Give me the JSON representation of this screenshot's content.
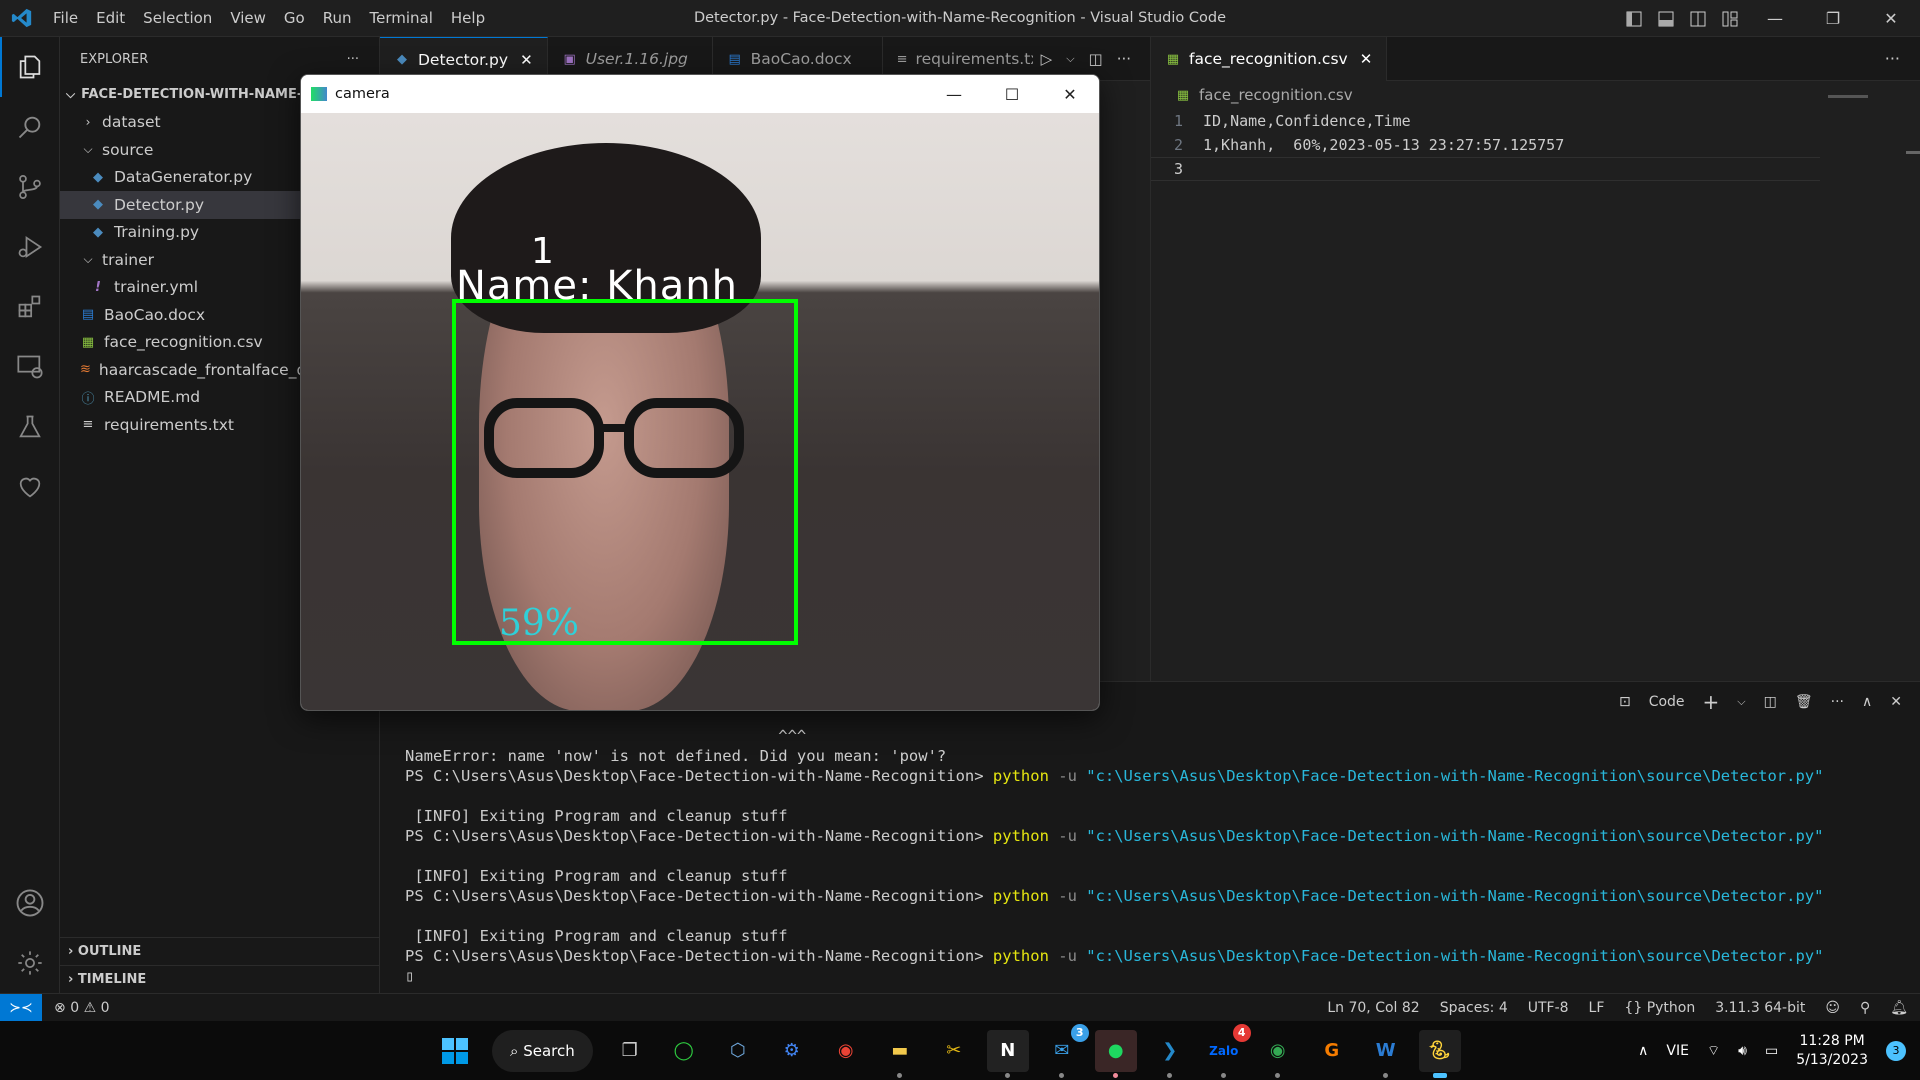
{
  "window": {
    "title": "Detector.py - Face-Detection-with-Name-Recognition - Visual Studio Code",
    "menu": [
      "File",
      "Edit",
      "Selection",
      "View",
      "Go",
      "Run",
      "Terminal",
      "Help"
    ]
  },
  "activity_bar": [
    "explorer-icon",
    "search-icon",
    "source-control-icon",
    "run-debug-icon",
    "extensions-icon",
    "remote-explorer-icon",
    "testing-icon",
    "favorites-icon"
  ],
  "sidebar": {
    "header": "EXPLORER",
    "more": "···",
    "root": "FACE-DETECTION-WITH-NAME-RECOGNITION",
    "items": [
      {
        "label": "dataset",
        "type": "folder",
        "expanded": false,
        "depth": 1
      },
      {
        "label": "source",
        "type": "folder",
        "expanded": true,
        "depth": 1
      },
      {
        "label": "DataGenerator.py",
        "type": "python",
        "depth": 2
      },
      {
        "label": "Detector.py",
        "type": "python",
        "depth": 2,
        "selected": true
      },
      {
        "label": "Training.py",
        "type": "python",
        "depth": 2
      },
      {
        "label": "trainer",
        "type": "folder",
        "expanded": true,
        "depth": 1
      },
      {
        "label": "trainer.yml",
        "type": "yaml",
        "depth": 2
      },
      {
        "label": "BaoCao.docx",
        "type": "word",
        "depth": 1
      },
      {
        "label": "face_recognition.csv",
        "type": "csv",
        "depth": 1
      },
      {
        "label": "haarcascade_frontalface_default.xml",
        "type": "xml",
        "depth": 1
      },
      {
        "label": "README.md",
        "type": "info",
        "depth": 1
      },
      {
        "label": "requirements.txt",
        "type": "text",
        "depth": 1
      }
    ],
    "outline": "OUTLINE",
    "timeline": "TIMELINE"
  },
  "tabs_left": [
    {
      "label": "Detector.py",
      "active": true,
      "close": "✕"
    },
    {
      "label": "User.1.16.jpg",
      "italic": true
    },
    {
      "label": "BaoCao.docx"
    },
    {
      "label": "requirements.txt"
    }
  ],
  "tabs_right": [
    {
      "label": "face_recognition.csv",
      "active": true,
      "close": "✕"
    }
  ],
  "csv_editor": {
    "breadcrumb": "face_recognition.csv",
    "lines": [
      {
        "n": "1",
        "text": "ID,Name,Confidence,Time"
      },
      {
        "n": "2",
        "text": "1,Khanh,  60%,2023-05-13 23:27:57.125757"
      },
      {
        "n": "3",
        "text": ""
      }
    ]
  },
  "camera_window": {
    "title": "camera",
    "overlay_id": "1",
    "overlay_name": "Name: Khanh",
    "overlay_confidence": "59%",
    "box_color": "#00ff00",
    "confidence_color": "#2fd0d8"
  },
  "panel": {
    "terminal_name": "Code",
    "lines": [
      {
        "plain": "                                        ^^^"
      },
      {
        "plain": "NameError: name 'now' is not defined. Did you mean: 'pow'?"
      },
      {
        "prompt": "PS C:\\Users\\Asus\\Desktop\\Face-Detection-with-Name-Recognition> ",
        "cmd": "python",
        "flag": " -u ",
        "path": "\"c:\\Users\\Asus\\Desktop\\Face-Detection-with-Name-Recognition\\source\\Detector.py\""
      },
      {
        "plain": ""
      },
      {
        "plain": " [INFO] Exiting Program and cleanup stuff"
      },
      {
        "prompt": "PS C:\\Users\\Asus\\Desktop\\Face-Detection-with-Name-Recognition> ",
        "cmd": "python",
        "flag": " -u ",
        "path": "\"c:\\Users\\Asus\\Desktop\\Face-Detection-with-Name-Recognition\\source\\Detector.py\""
      },
      {
        "plain": ""
      },
      {
        "plain": " [INFO] Exiting Program and cleanup stuff"
      },
      {
        "prompt": "PS C:\\Users\\Asus\\Desktop\\Face-Detection-with-Name-Recognition> ",
        "cmd": "python",
        "flag": " -u ",
        "path": "\"c:\\Users\\Asus\\Desktop\\Face-Detection-with-Name-Recognition\\source\\Detector.py\""
      },
      {
        "plain": ""
      },
      {
        "plain": " [INFO] Exiting Program and cleanup stuff"
      },
      {
        "prompt": "PS C:\\Users\\Asus\\Desktop\\Face-Detection-with-Name-Recognition> ",
        "cmd": "python",
        "flag": " -u ",
        "path": "\"c:\\Users\\Asus\\Desktop\\Face-Detection-with-Name-Recognition\\source\\Detector.py\""
      },
      {
        "plain": "▯"
      }
    ]
  },
  "status_bar": {
    "errors": "0",
    "warnings": "0",
    "position": "Ln 70, Col 82",
    "spaces": "Spaces: 4",
    "encoding": "UTF-8",
    "eol": "LF",
    "language": "Python",
    "interpreter": "3.11.3 64-bit"
  },
  "taskbar": {
    "search": "Search",
    "apps": [
      {
        "name": "task-view",
        "badge": null
      },
      {
        "name": "obs",
        "badge": null
      },
      {
        "name": "virtualbox",
        "badge": null
      },
      {
        "name": "android-studio",
        "badge": null
      },
      {
        "name": "chrome",
        "badge": null
      },
      {
        "name": "file-explorer",
        "badge": null
      },
      {
        "name": "tools",
        "badge": null
      },
      {
        "name": "notion",
        "badge": null
      },
      {
        "name": "mail",
        "badge": "3"
      },
      {
        "name": "spotify",
        "badge": null
      },
      {
        "name": "vscode",
        "badge": null
      },
      {
        "name": "zalo",
        "badge": "4"
      },
      {
        "name": "chrome-profile",
        "badge": null
      },
      {
        "name": "pdf",
        "badge": null
      },
      {
        "name": "word",
        "badge": null
      },
      {
        "name": "python",
        "badge": null
      }
    ],
    "language": "VIE",
    "time": "11:28 PM",
    "date": "5/13/2023",
    "notifications": "3"
  }
}
